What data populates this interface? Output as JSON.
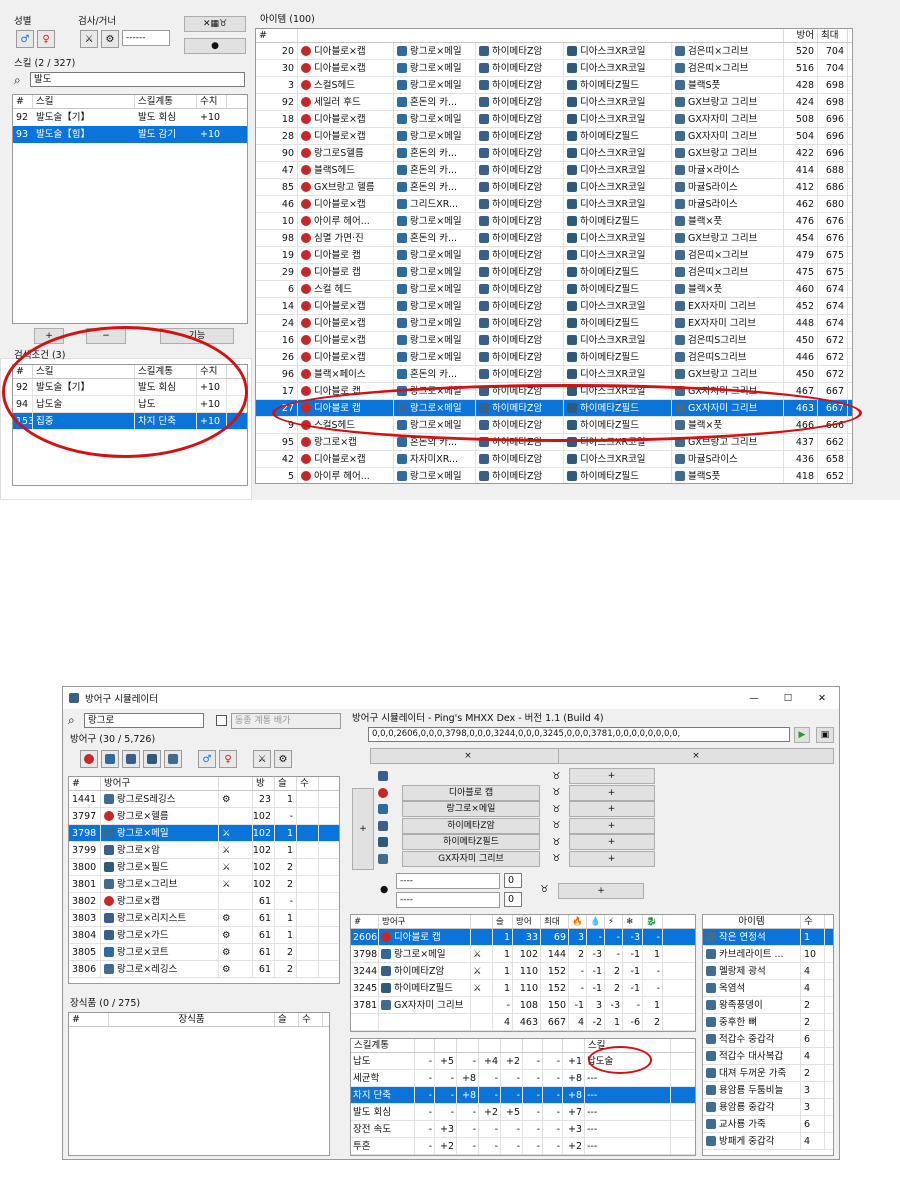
{
  "top": {
    "gender_label": "성별",
    "gunner_label": "검사/거너",
    "gunner_select": "------",
    "skill_header": "스킬 (2 / 327)",
    "skill_search": "발도",
    "skill_cols": [
      "#",
      "스킬",
      "스킬계통",
      "수치"
    ],
    "skill_rows": [
      [
        "92",
        "발도술【기】",
        "발도 회심",
        "+10"
      ],
      [
        "93",
        "발도술【힘】",
        "발도 감기",
        "+10"
      ]
    ],
    "add_label": "+",
    "remove_label": "−",
    "func_label": "기능",
    "cond_header": "검색조건 (3)",
    "cond_cols": [
      "#",
      "스킬",
      "스킬계통",
      "수치"
    ],
    "cond_rows": [
      [
        "92",
        "발도술【기】",
        "발도 회심",
        "+10"
      ],
      [
        "94",
        "납도술",
        "납도",
        "+10"
      ],
      [
        "153",
        "집중",
        "차지 단축",
        "+10"
      ]
    ],
    "items_header": "아이템 (100)",
    "item_cols": [
      "#",
      "방어",
      "최대"
    ],
    "items": [
      [
        "20",
        "디아블로×캡",
        "랑그로×메일",
        "하이메타Z암",
        "디아스크XR코일",
        "검은띠×그리브",
        "520",
        "704"
      ],
      [
        "30",
        "디아블로×캡",
        "랑그로×메일",
        "하이메타Z암",
        "디아스크XR코일",
        "검은띠×그리브",
        "516",
        "704"
      ],
      [
        "3",
        "스컬S헤드",
        "랑그로×메일",
        "하이메타Z암",
        "하이메타Z필드",
        "블랙S풋",
        "428",
        "698"
      ],
      [
        "92",
        "세일러 후드",
        "혼돈의 카...",
        "하이메타Z암",
        "디아스크XR코일",
        "GX브랑고 그리브",
        "424",
        "698"
      ],
      [
        "18",
        "디아블로×캡",
        "랑그로×메일",
        "하이메타Z암",
        "디아스크XR코일",
        "GX자자미 그리브",
        "508",
        "696"
      ],
      [
        "28",
        "디아블로×캡",
        "랑그로×메일",
        "하이메타Z암",
        "하이메타Z필드",
        "GX자자미 그리브",
        "504",
        "696"
      ],
      [
        "90",
        "랑그로S헬름",
        "혼돈의 카...",
        "하이메타Z암",
        "디아스크XR코일",
        "GX브랑고 그리브",
        "422",
        "696"
      ],
      [
        "47",
        "블랙S헤드",
        "혼돈의 카...",
        "하이메타Z암",
        "디아스크XR코일",
        "마귤×라이스",
        "414",
        "688"
      ],
      [
        "85",
        "GX브랑고 헬름",
        "혼돈의 카...",
        "하이메타Z암",
        "디아스크XR코일",
        "마귤S라이스",
        "412",
        "686"
      ],
      [
        "46",
        "디아블로×캡",
        "그리드XR...",
        "하이메타Z암",
        "디아스크XR코일",
        "마귤S라이스",
        "462",
        "680"
      ],
      [
        "10",
        "아이루 헤어...",
        "랑그로×메일",
        "하이메타Z암",
        "하이메타Z필드",
        "블랙×풋",
        "476",
        "676"
      ],
      [
        "98",
        "심멸 가면·진",
        "혼돈의 카...",
        "하이메타Z암",
        "디아스크XR코일",
        "GX브랑고 그리브",
        "454",
        "676"
      ],
      [
        "19",
        "디아블로 캡",
        "랑그로×메일",
        "하이메타Z암",
        "디아스크XR코일",
        "검은띠×그리브",
        "479",
        "675"
      ],
      [
        "29",
        "디아블로 캡",
        "랑그로×메일",
        "하이메타Z암",
        "하이메타Z필드",
        "검은띠×그리브",
        "475",
        "675"
      ],
      [
        "6",
        "스컬 헤드",
        "랑그로×메일",
        "하이메타Z암",
        "하이메타Z필드",
        "블랙×풋",
        "460",
        "674"
      ],
      [
        "14",
        "디아블로×캡",
        "랑그로×메일",
        "하이메타Z암",
        "디아스크XR코일",
        "EX자자미 그리브",
        "452",
        "674"
      ],
      [
        "24",
        "디아블로×캡",
        "랑그로×메일",
        "하이메타Z암",
        "하이메타Z필드",
        "EX자자미 그리브",
        "448",
        "674"
      ],
      [
        "16",
        "디아블로×캡",
        "랑그로×메일",
        "하이메타Z암",
        "디아스크XR코일",
        "검은띠S그리브",
        "450",
        "672"
      ],
      [
        "26",
        "디아블로×캡",
        "랑그로×메일",
        "하이메타Z암",
        "하이메타Z필드",
        "검은띠S그리브",
        "446",
        "672"
      ],
      [
        "96",
        "블랙×페이스",
        "혼돈의 카...",
        "하이메타Z암",
        "디아스크XR코일",
        "GX브랑고 그리브",
        "450",
        "672"
      ],
      [
        "17",
        "디아블로 캡",
        "랑그로×메일",
        "하이메타Z암",
        "디아스크XR코일",
        "GX자자미 그리브",
        "467",
        "667"
      ],
      [
        "27",
        "디아블로 캡",
        "랑그로×메일",
        "하이메타Z암",
        "하이메타Z필드",
        "GX자자미 그리브",
        "463",
        "667"
      ],
      [
        "9",
        "스컬S헤드",
        "랑그로×메일",
        "하이메타Z암",
        "하이메타Z필드",
        "블랙×풋",
        "466",
        "666"
      ],
      [
        "95",
        "랑그로×캡",
        "혼돈의 카...",
        "하이메타Z암",
        "디아스크XR코일",
        "GX브랑고 그리브",
        "437",
        "662"
      ],
      [
        "42",
        "디아블로×캡",
        "자자미XR...",
        "하이메타Z암",
        "디아스크XR코일",
        "마귤S라이스",
        "436",
        "658"
      ],
      [
        "5",
        "아이루 헤어...",
        "랑그로×메일",
        "하이메타Z암",
        "하이메타Z필드",
        "블랙S풋",
        "418",
        "652"
      ]
    ],
    "selected_item_index": 21
  },
  "bottom": {
    "window_title": "방어구 시뮬레이터",
    "min": "—",
    "max": "☐",
    "close": "✕",
    "search_value": "랑그로",
    "exclude_label": "동종 계통 배가",
    "armor_header": "방어구 (30 / 5,726)",
    "armor_cols": [
      "#",
      "방어구",
      "",
      "방",
      "슬",
      "수"
    ],
    "armor_rows": [
      [
        "1441",
        "랑그로S레깅스",
        "⚙",
        "23",
        "1",
        ""
      ],
      [
        "3797",
        "랑그로×헬름",
        "",
        "102",
        "-",
        ""
      ],
      [
        "3798",
        "랑그로×메일",
        "⚔",
        "102",
        "1",
        ""
      ],
      [
        "3799",
        "랑그로×암",
        "⚔",
        "102",
        "1",
        ""
      ],
      [
        "3800",
        "랑그로×필드",
        "⚔",
        "102",
        "2",
        ""
      ],
      [
        "3801",
        "랑그로×그리브",
        "⚔",
        "102",
        "2",
        ""
      ],
      [
        "3802",
        "랑그로×캡",
        "",
        "61",
        "-",
        ""
      ],
      [
        "3803",
        "랑그로×리지스트",
        "⚙",
        "61",
        "1",
        ""
      ],
      [
        "3804",
        "랑그로×가드",
        "⚙",
        "61",
        "1",
        ""
      ],
      [
        "3805",
        "랑그로×코트",
        "⚙",
        "61",
        "2",
        ""
      ],
      [
        "3806",
        "랑그로×레깅스",
        "⚙",
        "61",
        "2",
        ""
      ]
    ],
    "selected_armor_index": 2,
    "deco_header": "장식품 (0 / 275)",
    "deco_cols": [
      "#",
      "장식품",
      "슬",
      "수"
    ],
    "sim_title": "방어구 시뮬레이터 - Ping's MHXX Dex  - 버전 1.1 (Build 4)",
    "code_value": "0,0,0,2606,0,0,0,3798,0,0,0,3244,0,0,0,3245,0,0,0,3781,0,0,0,0,0,0,0,0,",
    "clear_label": "×",
    "set_pieces": [
      "디아블로 캡",
      "랑그로×메일",
      "하이메타Z암",
      "하이메타Z필드",
      "GX자자미 그리브"
    ],
    "plus": "+",
    "charm_select_1": "----",
    "charm_select_2": "----",
    "charm_num_1": "0",
    "charm_num_2": "0",
    "result_cols": [
      "#",
      "방어구",
      "",
      "슬",
      "방어",
      "최대",
      "🔥",
      "💧",
      "⚡",
      "❄",
      "🐉"
    ],
    "result_rows": [
      [
        "2606",
        "디아블로 캡",
        "",
        "1",
        "33",
        "69",
        "3",
        "-",
        "-",
        "-3",
        "-"
      ],
      [
        "3798",
        "랑그로×메일",
        "⚔",
        "1",
        "102",
        "144",
        "2",
        "-3",
        "-",
        "-1",
        "1"
      ],
      [
        "3244",
        "하이메타Z암",
        "⚔",
        "1",
        "110",
        "152",
        "-",
        "-1",
        "2",
        "-1",
        "-"
      ],
      [
        "3245",
        "하이메타Z필드",
        "⚔",
        "1",
        "110",
        "152",
        "-",
        "-1",
        "2",
        "-1",
        "-"
      ],
      [
        "3781",
        "GX자자미 그리브",
        "",
        "-",
        "108",
        "150",
        "-1",
        "3",
        "-3",
        "-",
        "1"
      ]
    ],
    "result_total": [
      "",
      "",
      "",
      "4",
      "463",
      "667",
      "4",
      "-2",
      "1",
      "-6",
      "2"
    ],
    "skills_cols": [
      "스킬계통",
      "",
      "",
      "",
      "",
      "",
      "",
      "",
      "",
      "",
      "스킬"
    ],
    "skills_rows": [
      [
        "납도",
        "-",
        "+5",
        "-",
        "+4",
        "+2",
        "-",
        "-",
        "+1",
        "",
        "납도술"
      ],
      [
        "세균학",
        "-",
        "-",
        "+8",
        "-",
        "-",
        "-",
        "-",
        "+8",
        "",
        "---"
      ],
      [
        "차지 단축",
        "-",
        "-",
        "+8",
        "-",
        "-",
        "-",
        "-",
        "+8",
        "",
        "---"
      ],
      [
        "발도 회심",
        "-",
        "-",
        "-",
        "+2",
        "+5",
        "-",
        "-",
        "+7",
        "",
        "---"
      ],
      [
        "장전 속도",
        "-",
        "+3",
        "-",
        "-",
        "-",
        "-",
        "-",
        "+3",
        "",
        "---"
      ],
      [
        "투혼",
        "-",
        "+2",
        "-",
        "-",
        "-",
        "-",
        "-",
        "+2",
        "",
        "---"
      ]
    ],
    "selected_skill_index": 2,
    "bag_cols": [
      "아이템",
      "수"
    ],
    "bag_rows": [
      [
        "작은 연정석",
        "1"
      ],
      [
        "카브레라이트 ...",
        "10"
      ],
      [
        "멜랑제 광석",
        "4"
      ],
      [
        "옥염석",
        "4"
      ],
      [
        "왕족풍뎅이",
        "2"
      ],
      [
        "중후한 뼈",
        "2"
      ],
      [
        "적갑수 중갑각",
        "6"
      ],
      [
        "적갑수 대사복갑",
        "4"
      ],
      [
        "대져 두꺼운 가죽",
        "2"
      ],
      [
        "용암룡 두툼비늘",
        "3"
      ],
      [
        "용암룡 중갑각",
        "3"
      ],
      [
        "교사룡 가죽",
        "6"
      ],
      [
        "방패게 중갑각",
        "4"
      ]
    ],
    "selected_bag_index": 0
  }
}
